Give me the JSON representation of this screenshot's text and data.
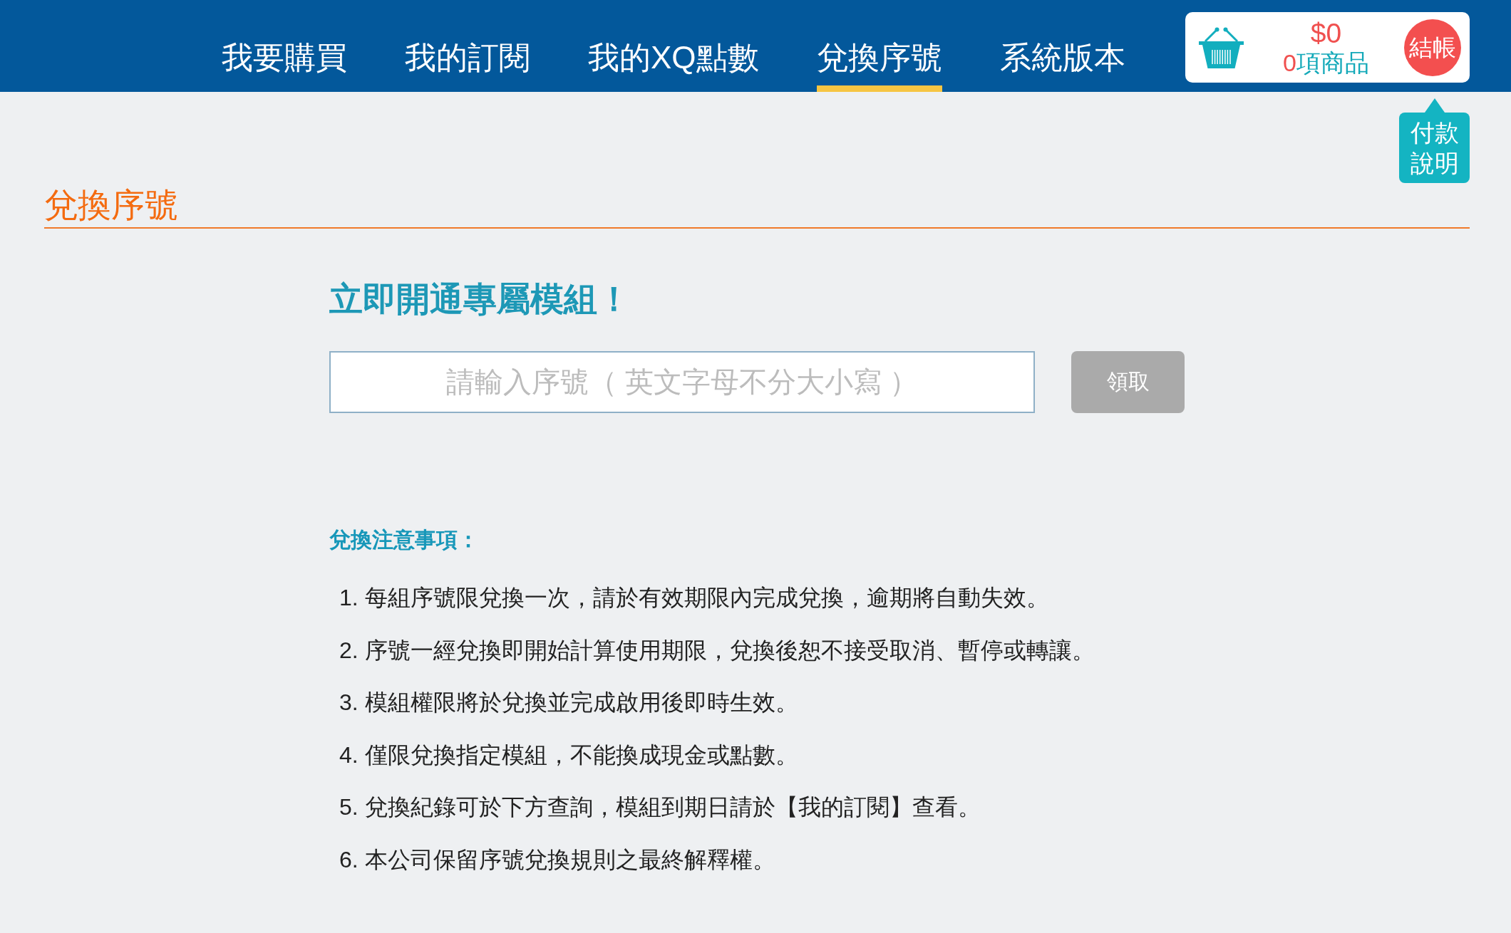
{
  "nav": {
    "items": [
      {
        "label": "我要購買",
        "selected": false
      },
      {
        "label": "我的訂閱",
        "selected": false
      },
      {
        "label": "我的XQ點數",
        "selected": false
      },
      {
        "label": "兌換序號",
        "selected": true
      },
      {
        "label": "系統版本",
        "selected": false
      }
    ]
  },
  "cart": {
    "total": "$0",
    "item_count": "0",
    "item_unit": "項商品",
    "checkout_label": "結帳"
  },
  "payment_help": {
    "label": "付款說明"
  },
  "page_title": "兌換序號",
  "redeem": {
    "heading": "立即開通專屬模組！",
    "placeholder": "請輸入序號（ 英文字母不分大小寫 ）",
    "button": "領取"
  },
  "notes": {
    "title": "兌換注意事項：",
    "items": [
      "1. 每組序號限兌換一次，請於有效期限內完成兌換，逾期將自動失效。",
      "2. 序號一經兌換即開始計算使用期限，兌換後恕不接受取消、暫停或轉讓。",
      "3. 模組權限將於兌換並完成啟用後即時生效。",
      "4. 僅限兌換指定模組，不能換成現金或點數。",
      "5. 兌換紀錄可於下方查詢，模組到期日請於【我的訂閱】查看。",
      "6. 本公司保留序號兌換規則之最終解釋權。"
    ]
  }
}
